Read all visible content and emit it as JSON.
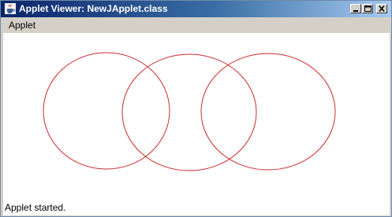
{
  "window": {
    "title": "Applet Viewer: NewJApplet.class",
    "app_icon": "java-cup-icon",
    "controls": [
      "minimize-icon",
      "maximize-icon",
      "close-icon"
    ]
  },
  "menubar": {
    "items": [
      {
        "label": "Applet"
      }
    ]
  },
  "canvas": {
    "shape_color": "#cc2a2a",
    "background": "#ffffff",
    "shapes": [
      "ellipse",
      "ellipse",
      "ellipse"
    ]
  },
  "status": {
    "text": "Applet started."
  }
}
